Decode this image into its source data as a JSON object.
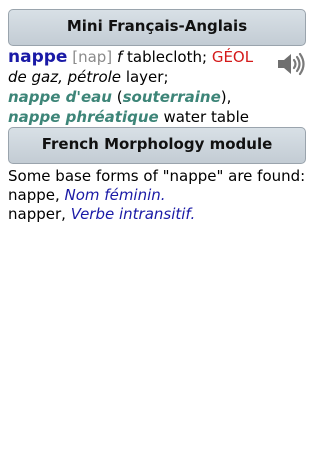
{
  "dictionary": {
    "title": "Mini Français-Anglais",
    "headword": "nappe",
    "pronunciation": "[nap]",
    "pos": "f",
    "sense1": "tablecloth;",
    "domain": "GÉOL",
    "context_pre": "de",
    "context_rest": "gaz, pétrole",
    "sense2": "layer;",
    "phrase1": "nappe d'eau",
    "phrase1_variant": "souterraine",
    "phrase2": "nappe phréatique",
    "phrase2_translation": "water table",
    "speaker_icon": "speaker-icon"
  },
  "morphology": {
    "title": "French Morphology module",
    "intro": "Some base forms of \"nappe\" are found:",
    "forms": [
      {
        "word": "nappe,",
        "tag": "Nom féminin."
      },
      {
        "word": "napper,",
        "tag": "Verbe intransitif."
      }
    ]
  }
}
